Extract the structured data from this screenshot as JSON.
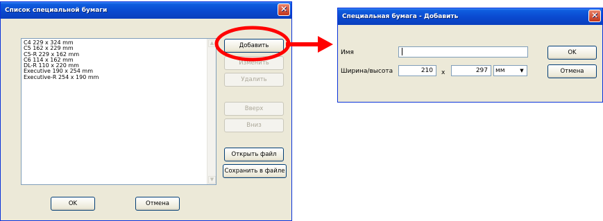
{
  "left_dialog": {
    "title": "Список специальной бумаги",
    "close_glyph": "✕",
    "list_items": [
      "C4 229 x 324 mm",
      "C5 162 x 229 mm",
      "C5-R 229 x 162 mm",
      "C6 114 x 162 mm",
      "DL-R 110 x 220 mm",
      "Executive 190 x 254 mm",
      "Executive-R 254 x 190 mm"
    ],
    "buttons": {
      "add": "Добавить",
      "edit": "Изменить",
      "delete": "Удалить",
      "up": "Вверх",
      "down": "Вниз",
      "open_file": "Открыть файл",
      "save_file": "Сохранить в файле",
      "ok": "OK",
      "cancel": "Отмена"
    }
  },
  "right_dialog": {
    "title": "Специальная бумага - Добавить",
    "close_glyph": "✕",
    "name_label": "Имя",
    "name_value": "",
    "size_label": "Ширина/высота",
    "width_value": "210",
    "separator": "x",
    "height_value": "297",
    "unit_selected": "мм",
    "buttons": {
      "ok": "OK",
      "cancel": "Отмена"
    }
  },
  "colors": {
    "highlight": "#ff0000",
    "title_bar": "#0a49cf"
  }
}
